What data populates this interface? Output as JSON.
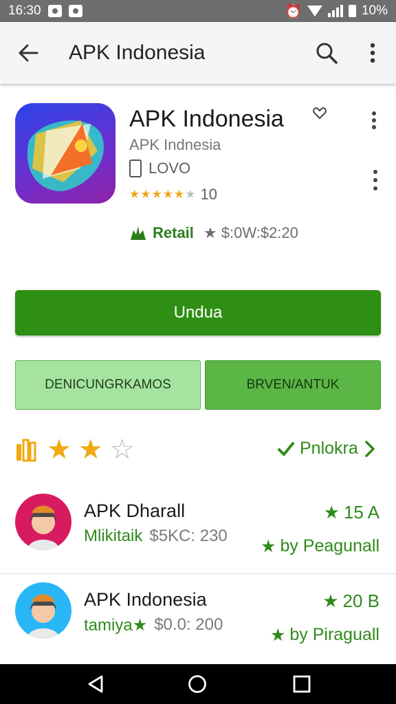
{
  "status_bar": {
    "time": "16:30",
    "battery": "10%"
  },
  "app_bar": {
    "title": "APK Indonesia"
  },
  "app": {
    "name": "APK Indonesia",
    "developer": "APK Indnesia",
    "device_label": "LOVO",
    "rating_count": "10",
    "retail_label": "Retail",
    "price_text": "$:0W:$2:20"
  },
  "install_button": {
    "label": "Undua"
  },
  "tabs": [
    {
      "label": "DENICUNGRKAMOS"
    },
    {
      "label": "BRVEN/ANTUK"
    }
  ],
  "rating_summary": {
    "stars_filled": 2,
    "stars_total": 3,
    "reviews_link": "Pnlokra"
  },
  "list_items": [
    {
      "title": "APK Dharall",
      "tag": "Mlikitaik",
      "price": "$5KC: 230",
      "badge": "15 A",
      "by": "by Peagunall",
      "avatar_bg": "#d81b60"
    },
    {
      "title": "APK Indonesia",
      "tag": "tamiya★",
      "price": "$0.0: 200",
      "badge": "20 B",
      "by": "by Piraguall",
      "avatar_bg": "#29b6f6"
    }
  ],
  "colors": {
    "primary_green": "#2f8f14",
    "star_yellow": "#f2a80f",
    "status_bar": "#6e6e6e"
  }
}
